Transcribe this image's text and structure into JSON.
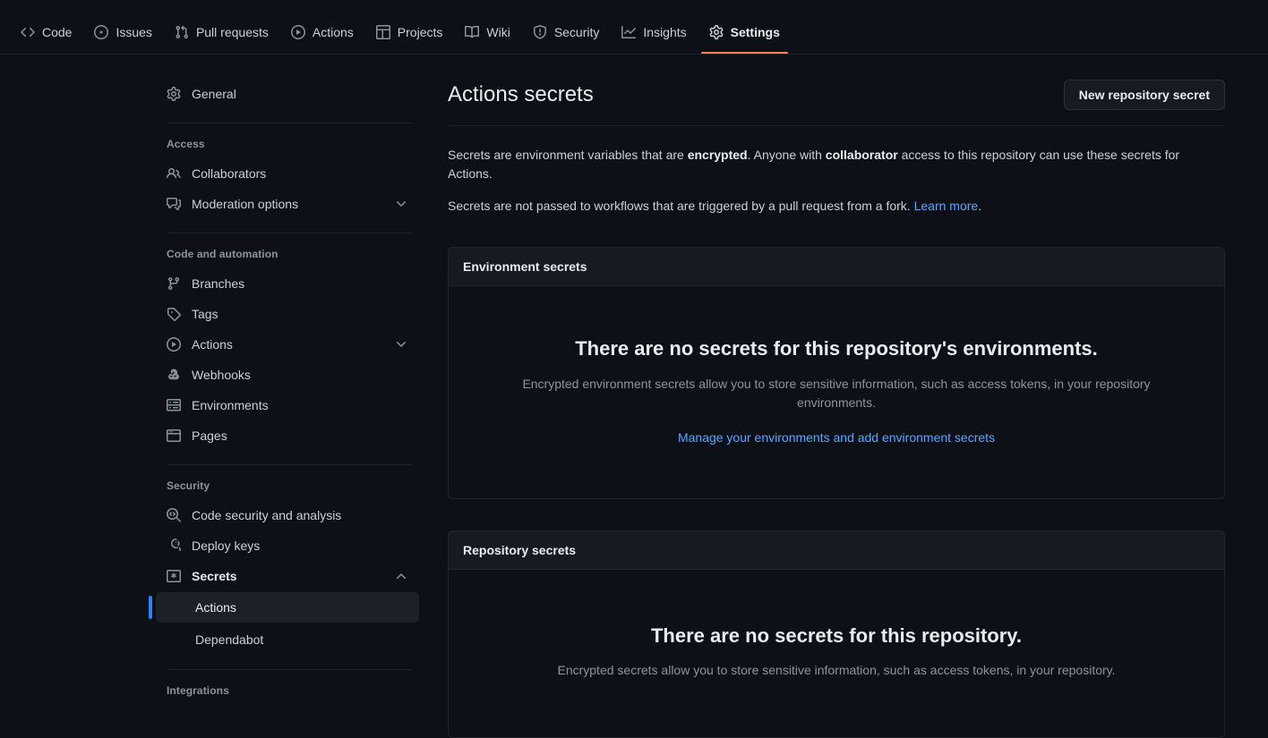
{
  "topnav": {
    "items": [
      {
        "label": "Code",
        "icon": "code-icon",
        "active": false
      },
      {
        "label": "Issues",
        "icon": "issue-opened-icon",
        "active": false
      },
      {
        "label": "Pull requests",
        "icon": "git-pull-request-icon",
        "active": false
      },
      {
        "label": "Actions",
        "icon": "play-circle-icon",
        "active": false
      },
      {
        "label": "Projects",
        "icon": "table-icon",
        "active": false
      },
      {
        "label": "Wiki",
        "icon": "book-icon",
        "active": false
      },
      {
        "label": "Security",
        "icon": "shield-icon",
        "active": false
      },
      {
        "label": "Insights",
        "icon": "graph-icon",
        "active": false
      },
      {
        "label": "Settings",
        "icon": "gear-icon",
        "active": true
      }
    ],
    "active_underline_color": "#f78166"
  },
  "sidebar": {
    "general": {
      "label": "General",
      "icon": "gear-icon"
    },
    "groups": [
      {
        "title": "Access",
        "items": [
          {
            "label": "Collaborators",
            "icon": "people-icon",
            "chevron": ""
          },
          {
            "label": "Moderation options",
            "icon": "comment-discussion-icon",
            "chevron": "chevron-down-icon"
          }
        ]
      },
      {
        "title": "Code and automation",
        "items": [
          {
            "label": "Branches",
            "icon": "git-branch-icon",
            "chevron": ""
          },
          {
            "label": "Tags",
            "icon": "tag-icon",
            "chevron": ""
          },
          {
            "label": "Actions",
            "icon": "play-circle-icon",
            "chevron": "chevron-down-icon"
          },
          {
            "label": "Webhooks",
            "icon": "webhook-icon",
            "chevron": ""
          },
          {
            "label": "Environments",
            "icon": "server-icon",
            "chevron": ""
          },
          {
            "label": "Pages",
            "icon": "browser-icon",
            "chevron": ""
          }
        ]
      },
      {
        "title": "Security",
        "items": [
          {
            "label": "Code security and analysis",
            "icon": "codescan-icon",
            "chevron": ""
          },
          {
            "label": "Deploy keys",
            "icon": "key-icon",
            "chevron": ""
          },
          {
            "label": "Secrets",
            "icon": "asterisk-box-icon",
            "chevron": "chevron-up-icon",
            "bold": true
          }
        ],
        "subitems": [
          {
            "label": "Actions",
            "selected": true
          },
          {
            "label": "Dependabot",
            "selected": false
          }
        ]
      },
      {
        "title": "Integrations",
        "items": []
      }
    ],
    "selected_bar_color": "#2f81f7"
  },
  "main": {
    "title": "Actions secrets",
    "new_secret_button": "New repository secret",
    "description_1": {
      "part1": "Secrets are environment variables that are ",
      "bold1": "encrypted",
      "part2": ". Anyone with ",
      "bold2": "collaborator",
      "part3": " access to this repository can use these secrets for Actions."
    },
    "description_2": {
      "text": "Secrets are not passed to workflows that are triggered by a pull request from a fork. ",
      "link": "Learn more",
      "after": "."
    },
    "environment_secrets": {
      "header": "Environment secrets",
      "blank_title": "There are no secrets for this repository's environments.",
      "blank_sub": "Encrypted environment secrets allow you to store sensitive information, such as access tokens, in your repository environments.",
      "link": "Manage your environments and add environment secrets"
    },
    "repository_secrets": {
      "header": "Repository secrets",
      "blank_title": "There are no secrets for this repository.",
      "blank_sub": "Encrypted secrets allow you to store sensitive information, such as access tokens, in your repository."
    }
  }
}
